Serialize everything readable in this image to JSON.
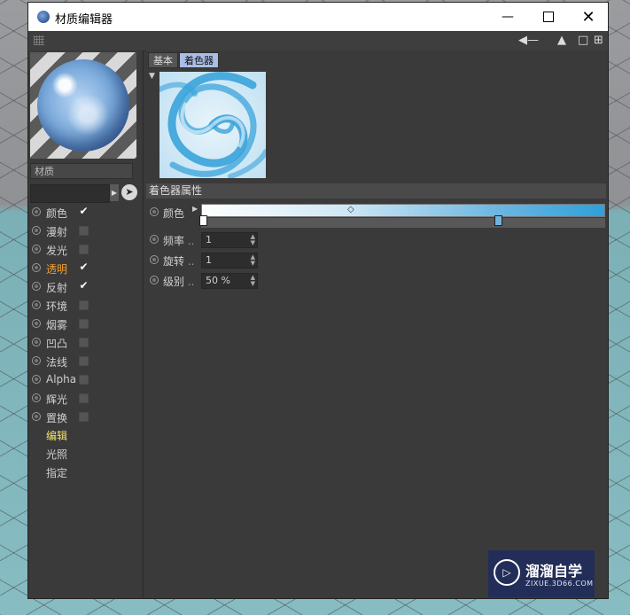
{
  "window": {
    "title": "材质编辑器"
  },
  "left": {
    "material_name": "材质",
    "channels": [
      {
        "label": "颜色",
        "checked": true,
        "color": "#cfcfcf"
      },
      {
        "label": "漫射",
        "checked": false,
        "color": "#cfcfcf"
      },
      {
        "label": "发光",
        "checked": false,
        "color": "#cfcfcf"
      },
      {
        "label": "透明",
        "checked": true,
        "color": "#f0a030"
      },
      {
        "label": "反射",
        "checked": true,
        "color": "#cfcfcf"
      },
      {
        "label": "环境",
        "checked": false,
        "color": "#cfcfcf"
      },
      {
        "label": "烟雾",
        "checked": false,
        "color": "#cfcfcf"
      },
      {
        "label": "凹凸",
        "checked": false,
        "color": "#cfcfcf"
      },
      {
        "label": "法线",
        "checked": false,
        "color": "#cfcfcf"
      },
      {
        "label": "Alpha",
        "checked": false,
        "color": "#cfcfcf"
      },
      {
        "label": "辉光",
        "checked": false,
        "color": "#cfcfcf"
      },
      {
        "label": "置换",
        "checked": false,
        "color": "#cfcfcf"
      }
    ],
    "sections": [
      {
        "label": "编辑",
        "color": "#f2e36a"
      },
      {
        "label": "光照",
        "color": "#cfcfcf"
      },
      {
        "label": "指定",
        "color": "#cfcfcf"
      }
    ]
  },
  "tabs": [
    {
      "label": "基本",
      "active": false
    },
    {
      "label": "着色器",
      "active": true
    }
  ],
  "shader": {
    "section_title": "着色器属性",
    "color_label": "颜色",
    "gradient_colors": [
      "#ffffff",
      "#cfe8f6",
      "#6fb8e2",
      "#2ea0da"
    ],
    "frequency": {
      "label": "频率",
      "dots": "..",
      "value": "1"
    },
    "rotation": {
      "label": "旋转",
      "dots": "..",
      "value": "1"
    },
    "level": {
      "label": "级别",
      "dots": "..",
      "value": "50 %"
    }
  },
  "watermark": {
    "title": "溜溜自学",
    "url": "ZIXUE.3D66.COM"
  },
  "icons": [
    "app-icon",
    "minimize-icon",
    "maximize-icon",
    "close-icon",
    "grip-icon",
    "back-arrow-icon",
    "forward-arrow-icon",
    "lock-icon",
    "new-window-icon",
    "pick-cursor-icon",
    "expand-arrow-icon"
  ]
}
